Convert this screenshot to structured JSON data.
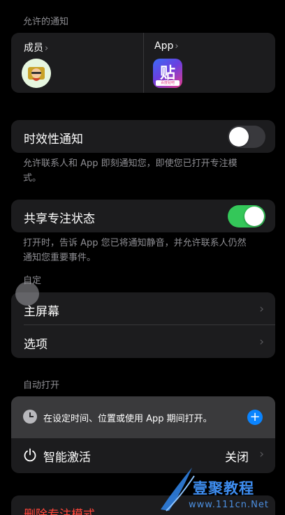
{
  "allowed_notifications": {
    "header": "允许的通知",
    "people_label": "成员",
    "apps_label": "App",
    "chevron": "›",
    "app_icon_glyph": "贴",
    "app_icon_caption": "百度贴吧"
  },
  "time_sensitive": {
    "label": "时效性通知",
    "enabled": false,
    "footnote": "允许联系人和 App 即刻通知您，即使您已打开专注模式。"
  },
  "share_focus": {
    "label": "共享专注状态",
    "enabled": true,
    "footnote": "打开时，告诉 App 您已将通知静音，并允许联系人仍然通知您重要事件。"
  },
  "customize": {
    "header": "自定",
    "items": [
      {
        "label": "主屏幕"
      },
      {
        "label": "选项"
      }
    ]
  },
  "auto_on": {
    "header": "自动打开",
    "add_schedule": "在设定时间、位置或使用 App 期间打开。",
    "smart_activation_label": "智能激活",
    "smart_activation_value": "关闭"
  },
  "delete_focus": {
    "label": "删除专注模式"
  },
  "watermark": {
    "brand": "壹聚教程",
    "domain": "www.111cn.Net"
  },
  "colors": {
    "accent_blue": "#0a84ff",
    "toggle_on": "#34c759",
    "destructive": "#ff453a"
  }
}
